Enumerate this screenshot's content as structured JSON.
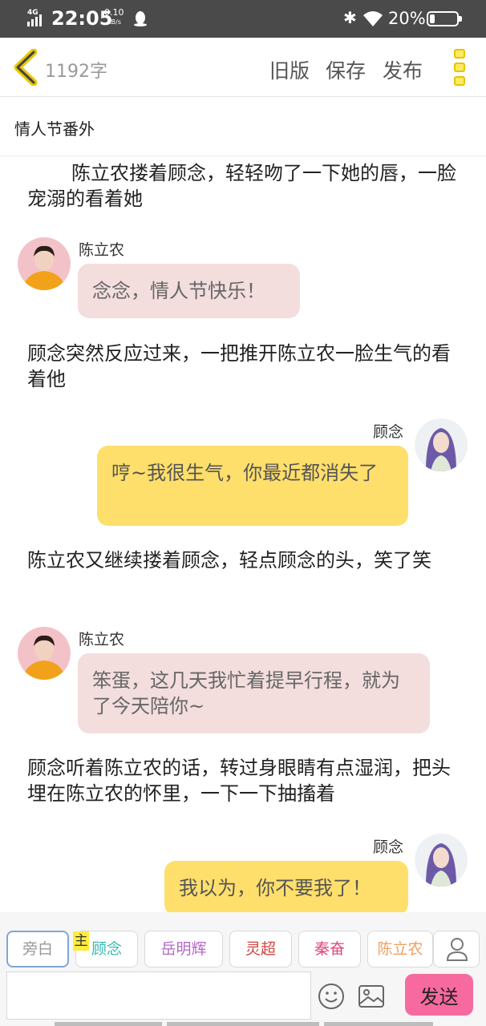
{
  "status_bar": {
    "network": "4G",
    "time": "22:05",
    "speed_value": "0.10",
    "speed_unit": "KB/s",
    "battery_percent": "20%",
    "battery_level": 0.2
  },
  "header": {
    "word_count": "1192字",
    "old_version_label": "旧版",
    "save_label": "保存",
    "publish_label": "发布"
  },
  "chapter_title": "情人节番外",
  "story": [
    {
      "type": "narration",
      "text": "陈立农搂着顾念，轻轻吻了一下她的唇，一脸宠溺的看着她"
    },
    {
      "type": "dialogue",
      "speaker": "陈立农",
      "text": "念念，情人节快乐！"
    },
    {
      "type": "narration",
      "text": "顾念突然反应过来，一把推开陈立农一脸生气的看着他"
    },
    {
      "type": "dialogue",
      "speaker": "顾念",
      "text": "哼~我很生气，你最近都消失了"
    },
    {
      "type": "narration",
      "text": "陈立农又继续搂着顾念，轻点顾念的头，笑了笑"
    },
    {
      "type": "dialogue",
      "speaker": "陈立农",
      "text": "笨蛋，这几天我忙着提早行程，就为了今天陪你~"
    },
    {
      "type": "narration",
      "text": "顾念听着陈立农的话，转过身眼睛有点湿润，把头埋在陈立农的怀里，一下一下抽搐着"
    },
    {
      "type": "dialogue",
      "speaker": "顾念",
      "text": "我以为，你不要我了！"
    }
  ],
  "characters": [
    {
      "label": "旁白",
      "color": "#999999",
      "active": true
    },
    {
      "label": "顾念",
      "color": "#35b8b0",
      "host": true
    },
    {
      "label": "岳明辉",
      "color": "#b565c8"
    },
    {
      "label": "灵超",
      "color": "#d0453e"
    },
    {
      "label": "秦奋",
      "color": "#e0457a"
    },
    {
      "label": "陈立农",
      "color": "#f0a060"
    }
  ],
  "host_badge": "主",
  "composer": {
    "input_value": "",
    "send_label": "发送"
  },
  "colors": {
    "accent_yellow": "#ffdf6b",
    "pink_bubble": "#f3dddd",
    "send_button": "#f76aa0"
  }
}
